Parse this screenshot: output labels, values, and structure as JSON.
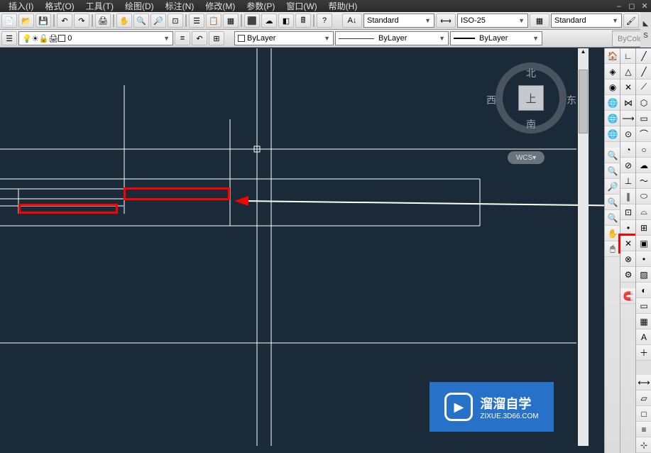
{
  "menu": {
    "insert": "插入(I)",
    "format": "格式(O)",
    "tools": "工具(T)",
    "draw": "绘图(D)",
    "dimension": "标注(N)",
    "modify": "修改(M)",
    "param": "参数(P)",
    "window": "窗口(W)",
    "help": "帮助(H)"
  },
  "toolbar1": {
    "text_style": "Standard",
    "dim_style": "ISO-25",
    "table_style": "Standard",
    "s_button": "S"
  },
  "toolbar2": {
    "layer_name": "0",
    "prop_layer": "ByLayer",
    "prop_linetype": "ByLayer",
    "prop_lineweight": "ByLayer",
    "bycolor": "ByColor"
  },
  "viewcube": {
    "top": "上",
    "north": "北",
    "south": "南",
    "east": "东",
    "west": "西",
    "wcs": "WCS"
  },
  "watermark": {
    "title": "溜溜自学",
    "url": "ZIXUE.3D66.COM"
  }
}
